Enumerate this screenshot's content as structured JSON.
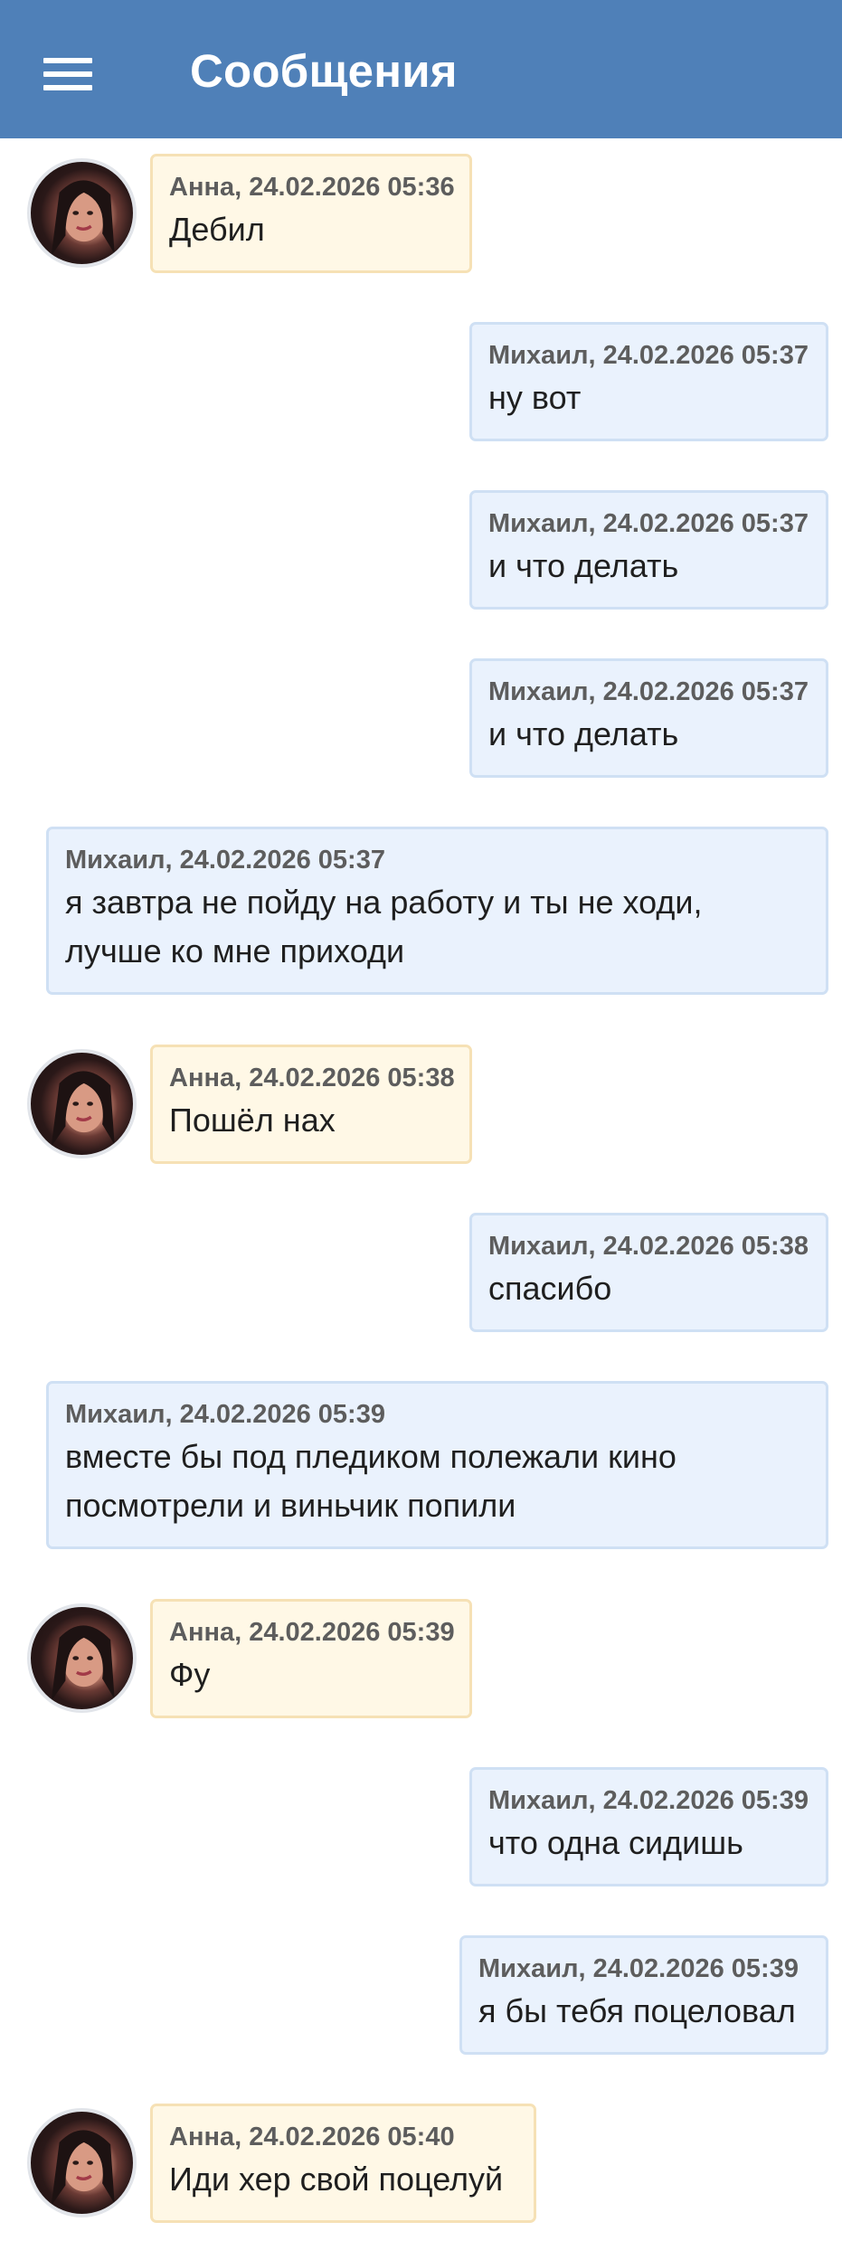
{
  "header": {
    "title": "Сообщения"
  },
  "messages": [
    {
      "sender": "Анна, 24.02.2026 05:36",
      "text": "Дебил"
    },
    {
      "sender": "Михаил, 24.02.2026 05:37",
      "text": "ну вот"
    },
    {
      "sender": "Михаил, 24.02.2026 05:37",
      "text": "и что делать"
    },
    {
      "sender": "Михаил, 24.02.2026 05:37",
      "text": "и что делать"
    },
    {
      "sender": "Михаил, 24.02.2026 05:37",
      "text": "я завтра не пойду на работу и ты не ходи, лучше ко мне приходи"
    },
    {
      "sender": "Анна, 24.02.2026 05:38",
      "text": "Пошёл нах"
    },
    {
      "sender": "Михаил, 24.02.2026 05:38",
      "text": "спасибо"
    },
    {
      "sender": "Михаил, 24.02.2026 05:39",
      "text": "вместе бы под пледиком полежали кино посмотрели и виньчик попили"
    },
    {
      "sender": "Анна, 24.02.2026 05:39",
      "text": "Фу"
    },
    {
      "sender": "Михаил, 24.02.2026 05:39",
      "text": "что одна сидишь"
    },
    {
      "sender": "Михаил, 24.02.2026 05:39",
      "text": "я бы тебя поцеловал"
    },
    {
      "sender": "Анна, 24.02.2026 05:40",
      "text": "Иди хер свой поцелуй"
    }
  ]
}
